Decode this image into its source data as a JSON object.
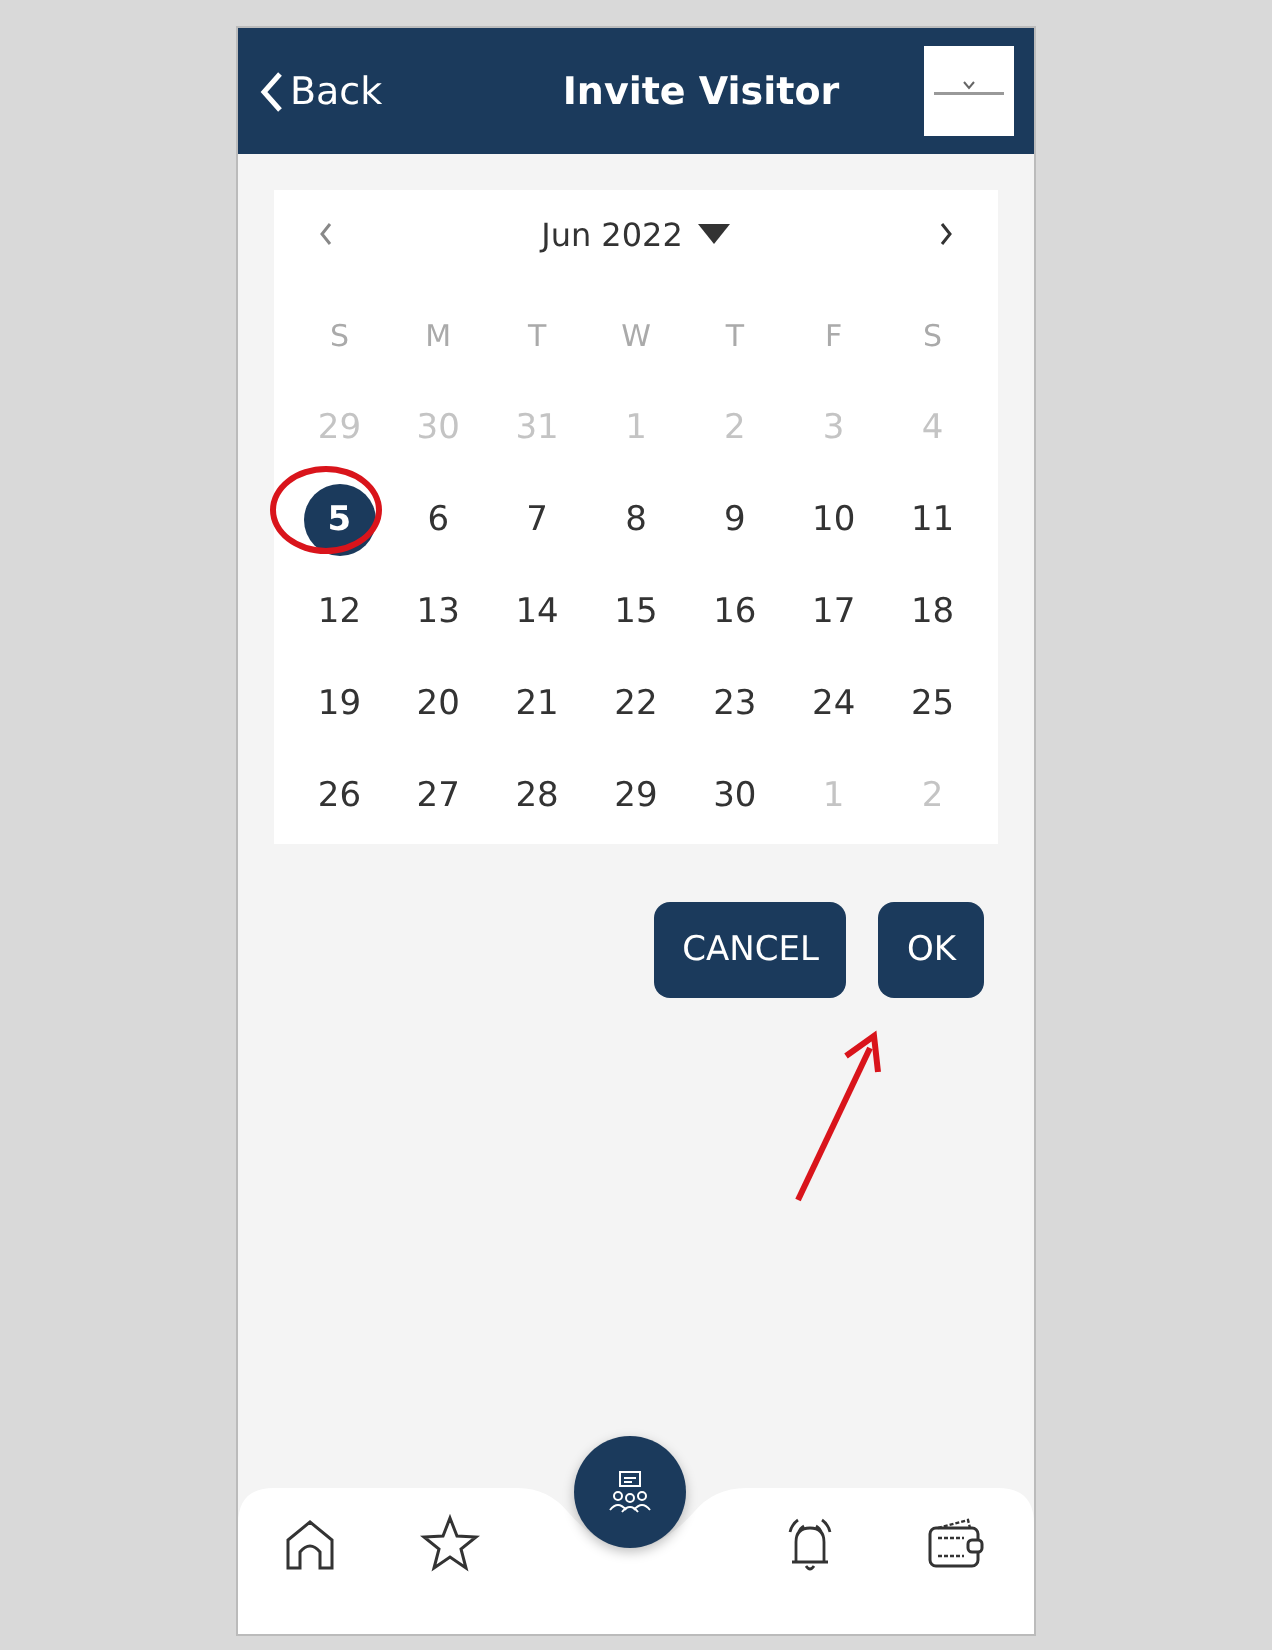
{
  "header": {
    "back": "Back",
    "title": "Invite Visitor"
  },
  "calendar": {
    "month": "Jun 2022",
    "weekdays": [
      "S",
      "M",
      "T",
      "W",
      "T",
      "F",
      "S"
    ],
    "weeks": [
      [
        {
          "day": "29",
          "muted": true,
          "selected": false
        },
        {
          "day": "30",
          "muted": true,
          "selected": false
        },
        {
          "day": "31",
          "muted": true,
          "selected": false
        },
        {
          "day": "1",
          "muted": true,
          "selected": false
        },
        {
          "day": "2",
          "muted": true,
          "selected": false
        },
        {
          "day": "3",
          "muted": true,
          "selected": false
        },
        {
          "day": "4",
          "muted": true,
          "selected": false
        }
      ],
      [
        {
          "day": "5",
          "muted": false,
          "selected": true
        },
        {
          "day": "6",
          "muted": false,
          "selected": false
        },
        {
          "day": "7",
          "muted": false,
          "selected": false
        },
        {
          "day": "8",
          "muted": false,
          "selected": false
        },
        {
          "day": "9",
          "muted": false,
          "selected": false
        },
        {
          "day": "10",
          "muted": false,
          "selected": false
        },
        {
          "day": "11",
          "muted": false,
          "selected": false
        }
      ],
      [
        {
          "day": "12",
          "muted": false,
          "selected": false
        },
        {
          "day": "13",
          "muted": false,
          "selected": false
        },
        {
          "day": "14",
          "muted": false,
          "selected": false
        },
        {
          "day": "15",
          "muted": false,
          "selected": false
        },
        {
          "day": "16",
          "muted": false,
          "selected": false
        },
        {
          "day": "17",
          "muted": false,
          "selected": false
        },
        {
          "day": "18",
          "muted": false,
          "selected": false
        }
      ],
      [
        {
          "day": "19",
          "muted": false,
          "selected": false
        },
        {
          "day": "20",
          "muted": false,
          "selected": false
        },
        {
          "day": "21",
          "muted": false,
          "selected": false
        },
        {
          "day": "22",
          "muted": false,
          "selected": false
        },
        {
          "day": "23",
          "muted": false,
          "selected": false
        },
        {
          "day": "24",
          "muted": false,
          "selected": false
        },
        {
          "day": "25",
          "muted": false,
          "selected": false
        }
      ],
      [
        {
          "day": "26",
          "muted": false,
          "selected": false
        },
        {
          "day": "27",
          "muted": false,
          "selected": false
        },
        {
          "day": "28",
          "muted": false,
          "selected": false
        },
        {
          "day": "29",
          "muted": false,
          "selected": false
        },
        {
          "day": "30",
          "muted": false,
          "selected": false
        },
        {
          "day": "1",
          "muted": true,
          "selected": false
        },
        {
          "day": "2",
          "muted": true,
          "selected": false
        }
      ]
    ]
  },
  "buttons": [
    "CANCEL",
    "OK"
  ]
}
